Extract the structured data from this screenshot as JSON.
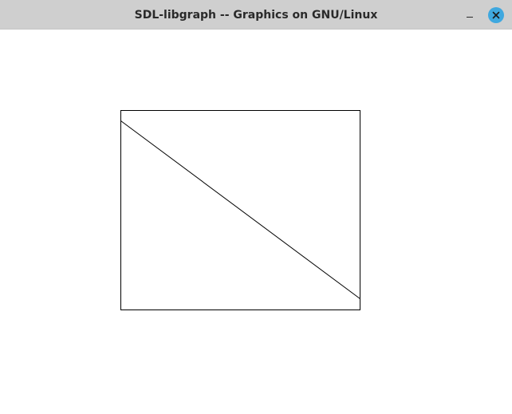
{
  "window": {
    "title": "SDL-libgraph -- Graphics on GNU/Linux"
  },
  "titlebar": {
    "minimize_icon": "minimize-icon",
    "close_icon": "close-icon",
    "close_color": "#3fa8df"
  },
  "canvas": {
    "background": "#ffffff",
    "stroke": "#000000"
  }
}
